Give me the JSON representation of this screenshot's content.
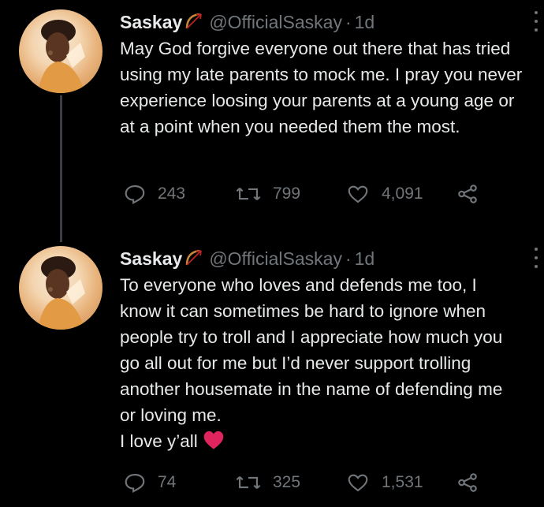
{
  "tweets": [
    {
      "name": "Saskay",
      "handle": "@OfficialSaskay",
      "separator": "·",
      "time": "1d",
      "text": "May God forgive everyone out there that has tried using my late parents to mock me. I pray you never experience loosing your parents at a young age or at a point when you needed them the most.",
      "replies": "243",
      "retweets": "799",
      "likes": "4,091"
    },
    {
      "name": "Saskay",
      "handle": "@OfficialSaskay",
      "separator": "·",
      "time": "1d",
      "text_lines": [
        "To everyone who loves and defends me too, I",
        "know it can sometimes be hard to ignore when",
        "people try to troll and I appreciate how much you",
        "go all out for me but I’d never support trolling",
        "another housemate in the name of defending me",
        "or loving me.",
        "I love y’all"
      ],
      "replies": "74",
      "retweets": "325",
      "likes": "1,531"
    }
  ],
  "icons": {
    "bow": "bow-and-arrow-emoji",
    "heart": "red-heart-emoji",
    "reply": "reply-icon",
    "retweet": "retweet-icon",
    "like": "like-icon",
    "share": "share-icon",
    "more": "more-icon"
  },
  "colors": {
    "background": "#000000",
    "text": "#e7e9ea",
    "muted": "#71767b",
    "heart": "#e0245e",
    "thread_line": "#3b3f43"
  }
}
